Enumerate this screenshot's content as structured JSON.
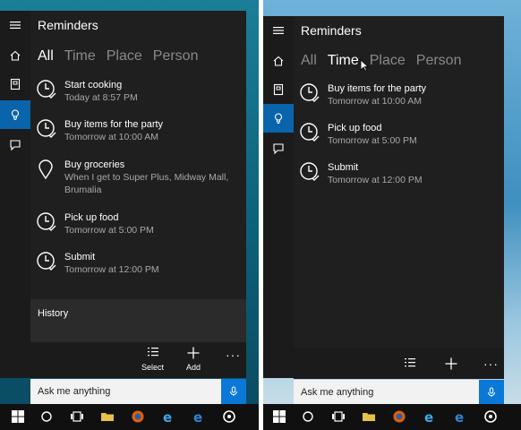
{
  "left": {
    "title": "Reminders",
    "tabs": [
      "All",
      "Time",
      "Place",
      "Person"
    ],
    "selected_tab": "All",
    "reminders": [
      {
        "icon": "clock-check-icon",
        "name": "Start cooking",
        "sub": "Today at 8:57 PM"
      },
      {
        "icon": "clock-check-icon",
        "name": "Buy items for the party",
        "sub": "Tomorrow at 10:00 AM"
      },
      {
        "icon": "location-pin-icon",
        "name": "Buy groceries",
        "sub": "When I get to Super Plus, Midway Mall,",
        "sub2": "Brumalia"
      },
      {
        "icon": "clock-check-icon",
        "name": "Pick up food",
        "sub": "Tomorrow at 5:00 PM"
      },
      {
        "icon": "clock-check-icon",
        "name": "Submit",
        "sub": "Tomorrow at 12:00 PM"
      }
    ],
    "history_label": "History",
    "commands": {
      "select_label": "Select",
      "add_label": "Add",
      "more": "···"
    },
    "search_placeholder": "Ask me anything"
  },
  "right": {
    "title": "Reminders",
    "tabs": [
      "All",
      "Time",
      "Place",
      "Person"
    ],
    "selected_tab": "Time",
    "reminders": [
      {
        "icon": "clock-check-icon",
        "name": "Buy items for the party",
        "sub": "Tomorrow at 10:00 AM"
      },
      {
        "icon": "clock-check-icon",
        "name": "Pick up food",
        "sub": "Tomorrow at 5:00 PM"
      },
      {
        "icon": "clock-check-icon",
        "name": "Submit",
        "sub": "Tomorrow at 12:00 PM"
      }
    ],
    "commands": {
      "more": "···"
    },
    "search_placeholder": "Ask me anything"
  },
  "sidebar_icons": [
    "hamburger-icon",
    "home-icon",
    "notebook-icon",
    "lightbulb-icon",
    "feedback-icon"
  ],
  "taskbar_icons": [
    "windows-start-icon",
    "cortana-circle-icon",
    "task-view-icon",
    "file-explorer-icon",
    "firefox-icon",
    "edge-icon",
    "internet-explorer-icon",
    "groove-icon"
  ],
  "colors": {
    "accent": "#0a64ab",
    "panel": "#1f1f1f",
    "mic": "#0a78d7"
  }
}
